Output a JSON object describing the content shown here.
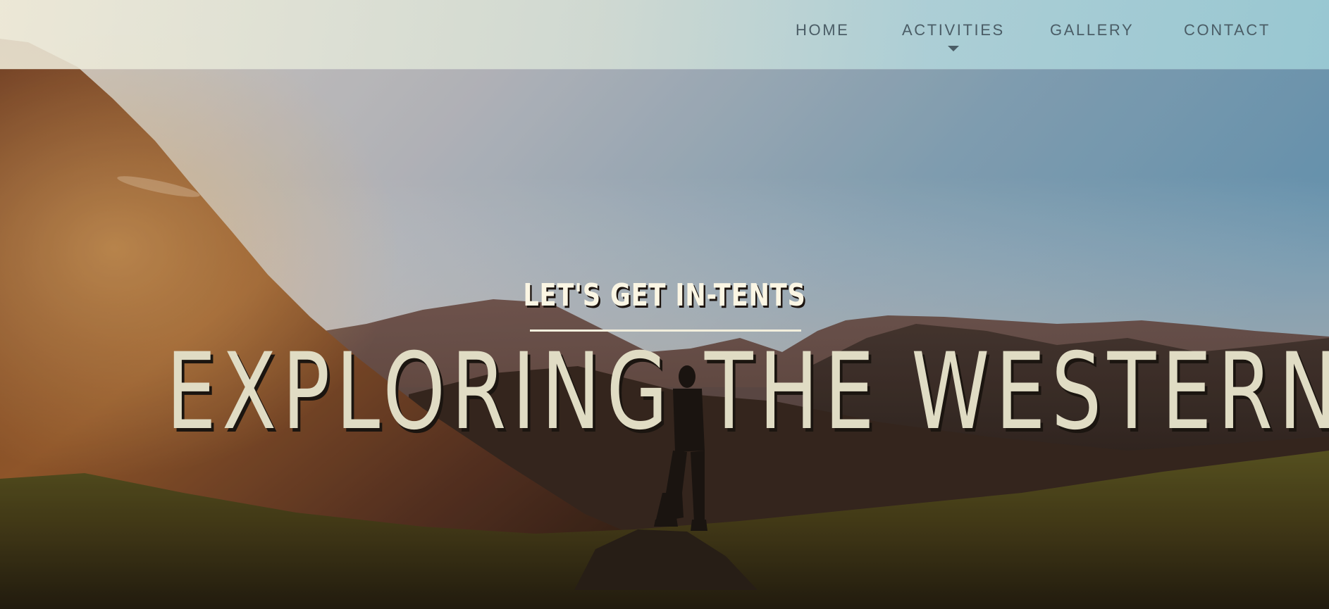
{
  "nav": {
    "items": [
      {
        "label": "HOME"
      },
      {
        "label": "ACTIVITIES"
      },
      {
        "label": "GALLERY"
      },
      {
        "label": "CONTACT"
      }
    ],
    "text_color": "#4b5d66",
    "dropdown_indicator_icon": "caret-down-icon"
  },
  "hero": {
    "tagline": "LET'S GET IN-TENTS",
    "headline": "EXPLORING THE WESTERN CAPE",
    "background": "mountain-sunset-hiker-photo"
  }
}
